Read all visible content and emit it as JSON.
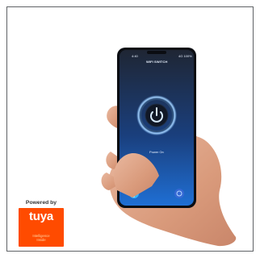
{
  "phone": {
    "status_time": "4:40",
    "status_right": "4G 100%",
    "device_name": "WIFI SWITCH",
    "power_label": "Power On"
  },
  "badge": {
    "powered_by": "Powered by",
    "brand": "tuya",
    "sub_line_1": "Intelligence",
    "sub_line_2": "Inside"
  },
  "colors": {
    "screen_top": "#1f2634",
    "screen_bottom": "#1f6fd4",
    "ring": "#79b9ff",
    "tuya_orange": "#ff4b00"
  },
  "icons": {
    "power": "power-icon",
    "fab": "plus-icon",
    "settings": "gear-icon"
  }
}
